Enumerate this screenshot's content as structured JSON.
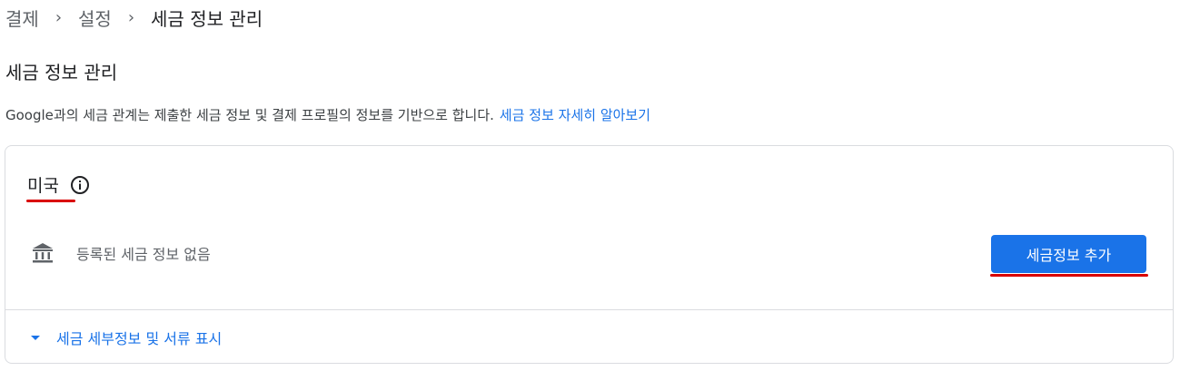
{
  "breadcrumb": {
    "items": [
      "결제",
      "설정",
      "세금 정보 관리"
    ],
    "separator": "›"
  },
  "page": {
    "title": "세금 정보 관리",
    "description": "Google과의 세금 관계는 제출한 세금 정보 및 결제 프로필의 정보를 기반으로 합니다.",
    "learn_more_link": "세금 정보 자세히 알아보기"
  },
  "card": {
    "country": "미국",
    "info_icon": "info-icon",
    "bank_icon": "bank-icon",
    "no_tax_info": "등록된 세금 정보 없음",
    "add_button": "세금정보 추가",
    "details_toggle": "세금 세부정보 및 서류 표시"
  },
  "colors": {
    "accent": "#1a73e8",
    "annotation_red": "#d90000",
    "border": "#dadce0",
    "secondary_text": "#5f6368"
  }
}
